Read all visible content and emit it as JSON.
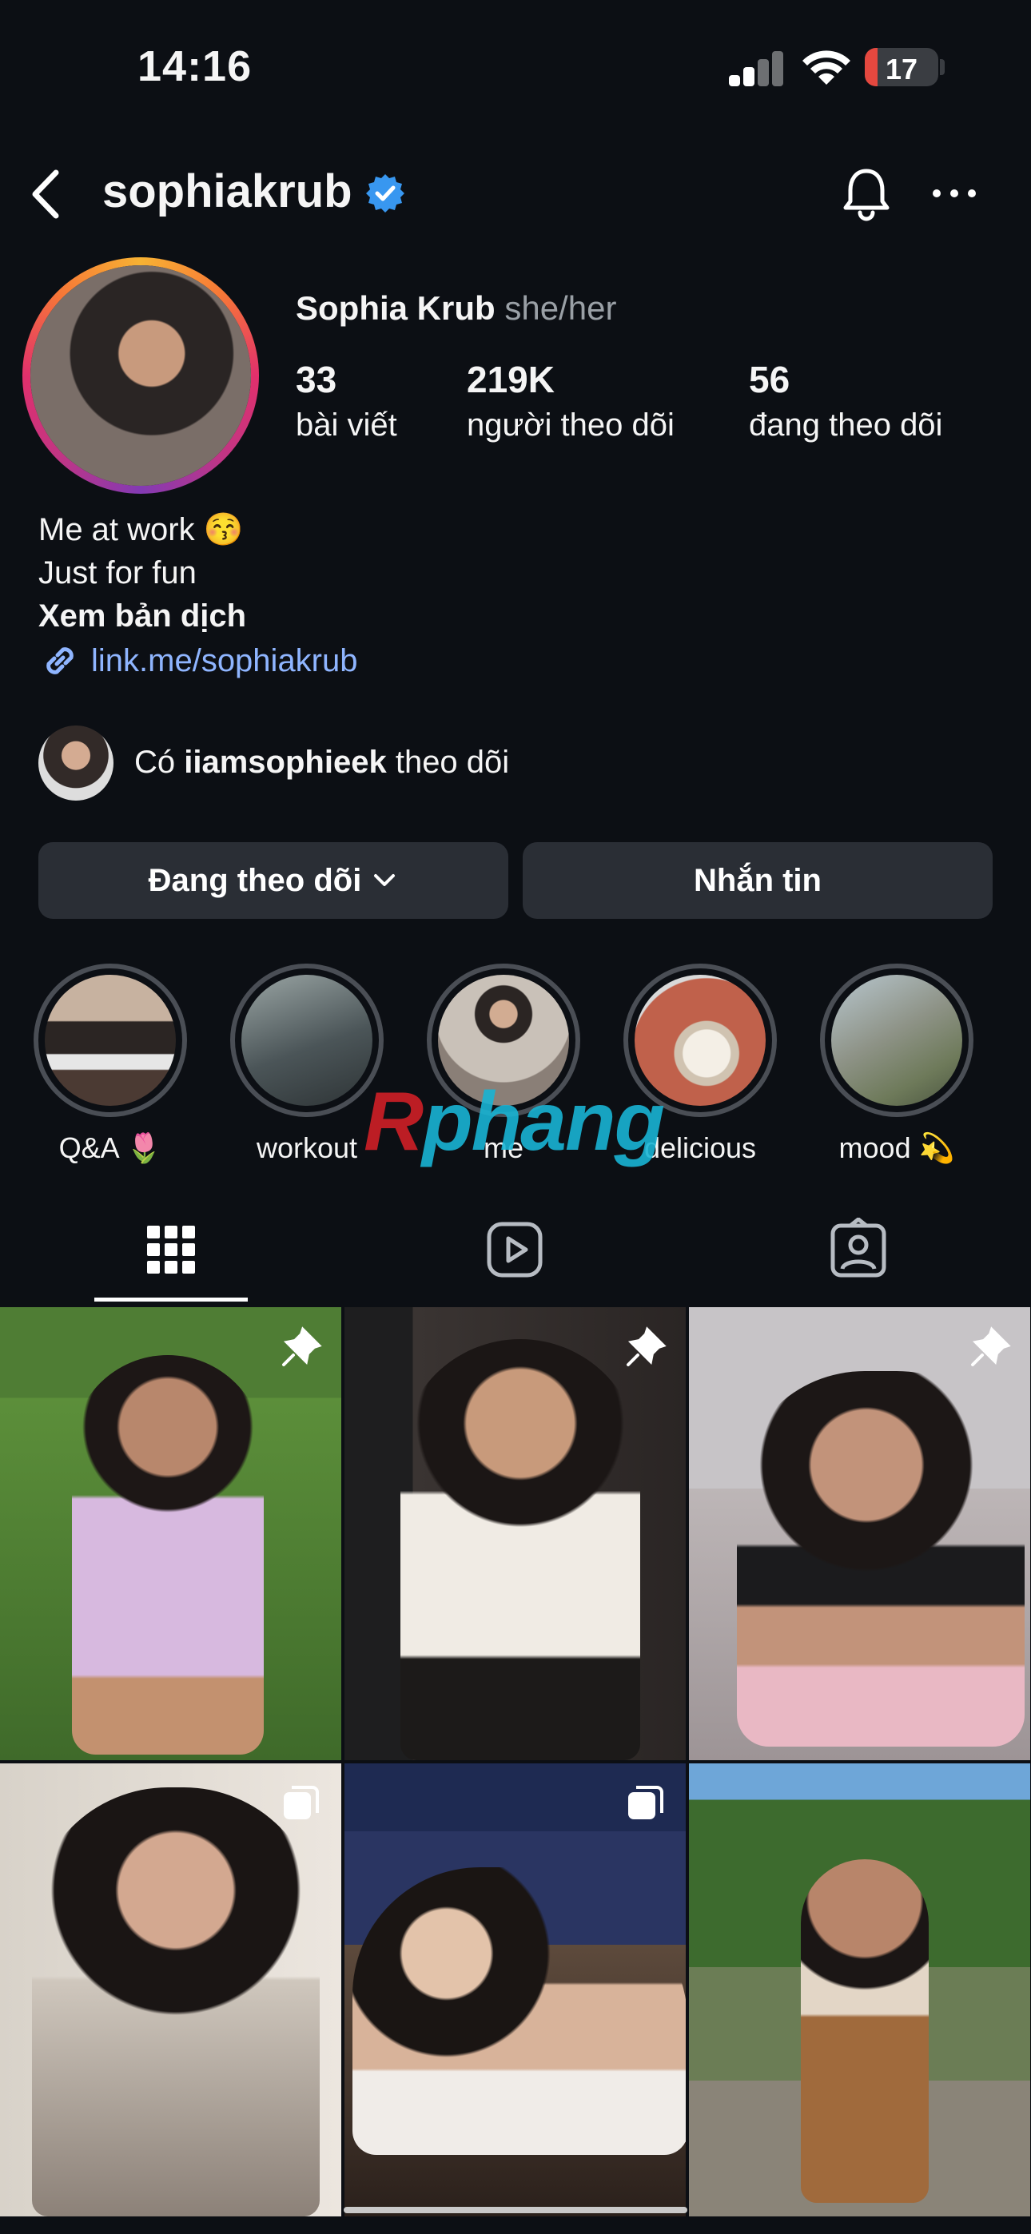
{
  "status_bar": {
    "time": "14:16",
    "battery": "17",
    "battery_level": 0.17
  },
  "header": {
    "username": "sophiakrub"
  },
  "profile": {
    "name": "Sophia Krub",
    "pronouns": "she/her",
    "stats": [
      {
        "value": "33",
        "label": "bài viết"
      },
      {
        "value": "219K",
        "label": "người theo dõi"
      },
      {
        "value": "56",
        "label": "đang theo dõi"
      }
    ],
    "bio_lines": [
      "Me at work 😚",
      "Just for fun"
    ],
    "translate": "Xem bản dịch",
    "link": "link.me/sophiakrub",
    "followed_by": {
      "prefix": "Có",
      "user": "iiamsophieek",
      "suffix": "theo dõi"
    }
  },
  "actions": {
    "following": "Đang theo dõi",
    "message": "Nhắn tin"
  },
  "highlights": [
    {
      "label": "Q&A 🌷"
    },
    {
      "label": "workout"
    },
    {
      "label": "me"
    },
    {
      "label": "delicious"
    },
    {
      "label": "mood 💫"
    }
  ],
  "watermark": {
    "a": "R",
    "b": "phang"
  },
  "tabs": [
    "grid-icon",
    "reels-icon",
    "tagged-icon"
  ],
  "grid": [
    {
      "badge": "pin-icon"
    },
    {
      "badge": "pin-icon"
    },
    {
      "badge": "pin-icon"
    },
    {
      "badge": "multi-photo-icon"
    },
    {
      "badge": "multi-photo-icon"
    },
    {
      "badge": ""
    }
  ],
  "colors": {
    "background": "#0c0f14",
    "button": "#2a2e35",
    "link": "#8fb5ff",
    "verified": "#3897f0"
  }
}
